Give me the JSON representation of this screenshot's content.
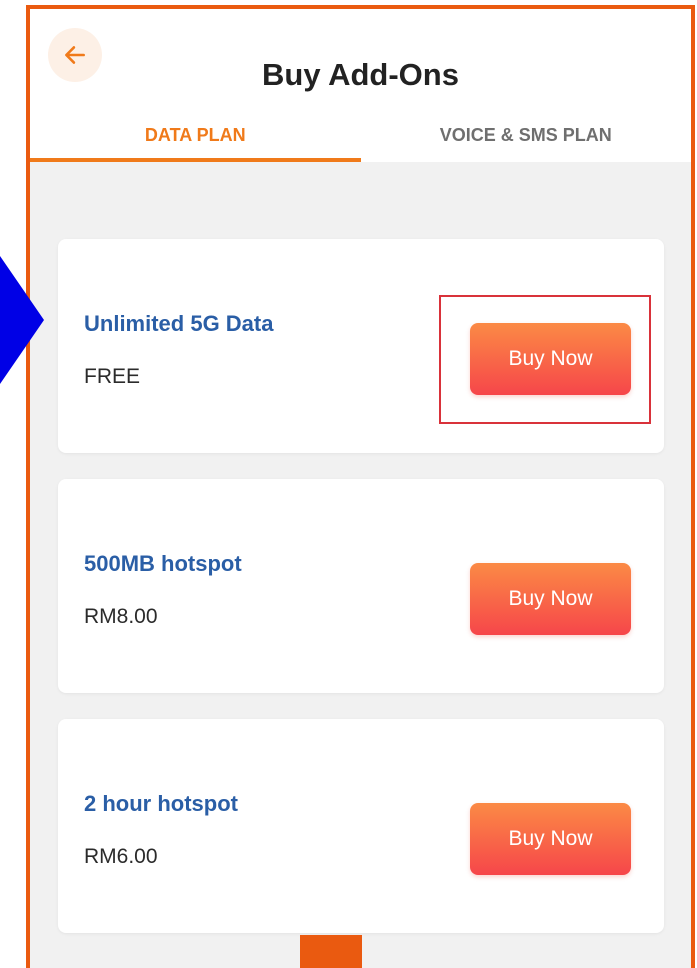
{
  "header": {
    "title": "Buy Add-Ons",
    "back_icon": "arrow-left-icon"
  },
  "tabs": [
    {
      "label": "DATA PLAN",
      "active": true
    },
    {
      "label": "VOICE & SMS PLAN",
      "active": false
    }
  ],
  "plans": [
    {
      "name": "Unlimited 5G Data",
      "price": "FREE",
      "button_label": "Buy Now",
      "highlighted": true
    },
    {
      "name": "500MB hotspot",
      "price": "RM8.00",
      "button_label": "Buy Now",
      "highlighted": false
    },
    {
      "name": "2 hour hotspot",
      "price": "RM6.00",
      "button_label": "Buy Now",
      "highlighted": false
    }
  ],
  "colors": {
    "accent": "#f07a1a",
    "frame": "#ea5a10",
    "pointer": "#0000e6",
    "plan_title": "#2a5ea6",
    "highlight": "#d9323a"
  }
}
